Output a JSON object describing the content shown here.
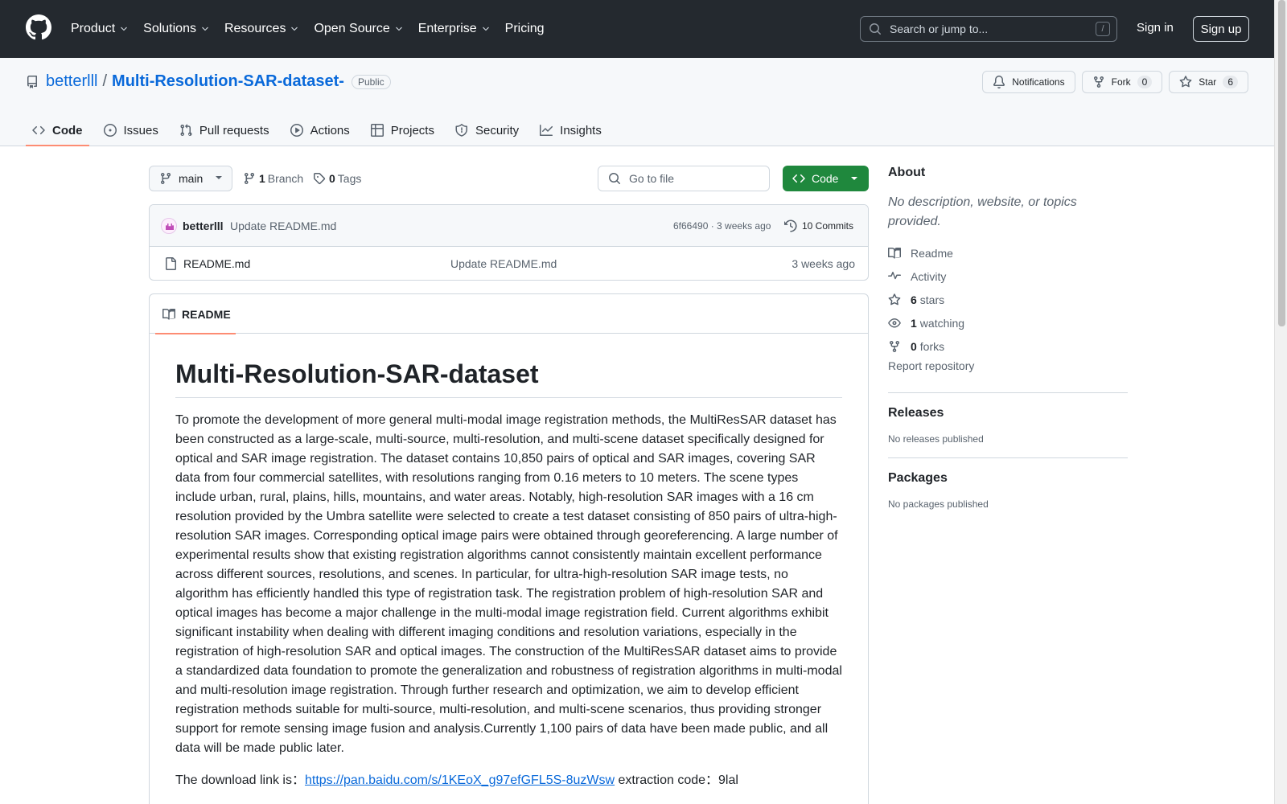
{
  "header": {
    "nav": [
      "Product",
      "Solutions",
      "Resources",
      "Open Source",
      "Enterprise",
      "Pricing"
    ],
    "search_placeholder": "Search or jump to...",
    "search_key": "/",
    "sign_in": "Sign in",
    "sign_up": "Sign up"
  },
  "repo": {
    "owner": "betterlll",
    "separator": "/",
    "name": "Multi-Resolution-SAR-dataset-",
    "visibility": "Public",
    "notifications_label": "Notifications",
    "fork_label": "Fork",
    "fork_count": "0",
    "star_label": "Star",
    "star_count": "6"
  },
  "tabs": [
    "Code",
    "Issues",
    "Pull requests",
    "Actions",
    "Projects",
    "Security",
    "Insights"
  ],
  "toolbar": {
    "branch": "main",
    "branch_count": "1",
    "branch_label": "Branch",
    "tag_count": "0",
    "tag_label": "Tags",
    "goto_file": "Go to file",
    "code_button": "Code"
  },
  "commit": {
    "author": "betterlll",
    "message": "Update README.md",
    "meta": "6f66490 · 3 weeks ago",
    "commits": "10 Commits"
  },
  "files": [
    {
      "name": "README.md",
      "commit": "Update README.md",
      "age": "3 weeks ago"
    }
  ],
  "readme": {
    "tab": "README",
    "title": "Multi-Resolution-SAR-dataset",
    "paragraph": "To promote the development of more general multi-modal image registration methods, the MultiResSAR dataset has been constructed as a large-scale, multi-source, multi-resolution, and multi-scene dataset specifically designed for optical and SAR image registration. The dataset contains 10,850 pairs of optical and SAR images, covering SAR data from four commercial satellites, with resolutions ranging from 0.16 meters to 10 meters. The scene types include urban, rural, plains, hills, mountains, and water areas. Notably, high-resolution SAR images with a 16 cm resolution provided by the Umbra satellite were selected to create a test dataset consisting of 850 pairs of ultra-high-resolution SAR images. Corresponding optical image pairs were obtained through georeferencing. A large number of experimental results show that existing registration algorithms cannot consistently maintain excellent performance across different sources, resolutions, and scenes. In particular, for ultra-high-resolution SAR image tests, no algorithm has efficiently handled this type of registration task. The registration problem of high-resolution SAR and optical images has become a major challenge in the multi-modal image registration field. Current algorithms exhibit significant instability when dealing with different imaging conditions and resolution variations, especially in the registration of high-resolution SAR and optical images. The construction of the MultiResSAR dataset aims to provide a standardized data foundation to promote the generalization and robustness of registration algorithms in multi-modal and multi-resolution image registration. Through further research and optimization, we aim to develop efficient registration methods suitable for multi-source, multi-resolution, and multi-scene scenarios, thus providing stronger support for remote sensing image fusion and analysis.Currently 1,100 pairs of data have been made public, and all data will be made public later.",
    "download_prefix": "The download link is：",
    "download_link": "https://pan.baidu.com/s/1KEoX_g97efGFL5S-8uzWsw",
    "download_suffix": " extraction code：9lal"
  },
  "about": {
    "heading": "About",
    "description": "No description, website, or topics provided.",
    "readme": "Readme",
    "activity": "Activity",
    "stars_count": "6",
    "stars_label": "stars",
    "watching_count": "1",
    "watching_label": "watching",
    "forks_count": "0",
    "forks_label": "forks",
    "report": "Report repository"
  },
  "releases": {
    "heading": "Releases",
    "none": "No releases published"
  },
  "packages": {
    "heading": "Packages",
    "none": "No packages published"
  },
  "colors": {
    "header_bg": "#24292f",
    "link": "#0969da",
    "code_button": "#1f883d",
    "tab_underline": "#fd8c73"
  }
}
